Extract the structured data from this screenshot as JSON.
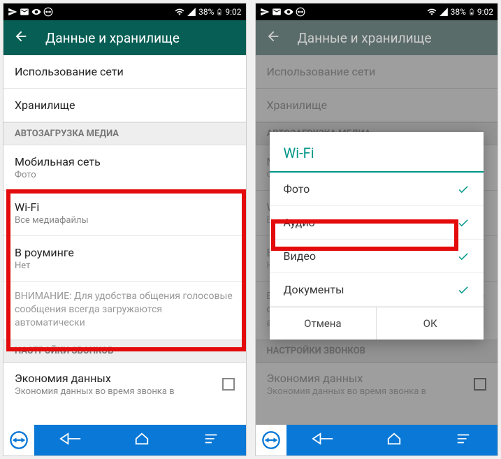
{
  "status": {
    "battery_pct": "38%",
    "time": "9:02"
  },
  "appbar": {
    "title": "Данные и хранилище"
  },
  "list": {
    "network_usage": "Использование сети",
    "storage": "Хранилище",
    "section_autoload": "АВТОЗАГРУЗКА МЕДИА",
    "mobile": {
      "title": "Мобильная сеть",
      "sub": "Фото"
    },
    "wifi": {
      "title": "Wi-Fi",
      "sub": "Все медиафайлы"
    },
    "roaming": {
      "title": "В роуминге",
      "sub": "Нет"
    },
    "notice": "ВНИМАНИЕ: Для удобства общения голосовые сообщения всегда загружаются автоматически",
    "section_calls": "НАСТРОЙКИ ЗВОНКОВ",
    "data_saver": {
      "title": "Экономия данных",
      "sub": "Экономия данных во время звонка в"
    }
  },
  "dialog": {
    "title": "Wi-Fi",
    "items": [
      {
        "label": "Фото",
        "checked": true
      },
      {
        "label": "Аудио",
        "checked": true
      },
      {
        "label": "Видео",
        "checked": true
      },
      {
        "label": "Документы",
        "checked": true
      }
    ],
    "cancel": "Отмена",
    "ok": "ОК"
  }
}
